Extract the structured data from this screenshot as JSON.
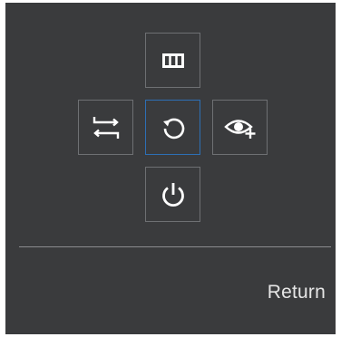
{
  "osd": {
    "tiles": {
      "top": {
        "icon": "picture-mode-icon"
      },
      "left": {
        "icon": "swap-arrows-icon"
      },
      "center": {
        "icon": "return-rotate-icon",
        "selected": true
      },
      "right": {
        "icon": "eye-saver-icon"
      },
      "bottom": {
        "icon": "power-icon"
      }
    },
    "footer": {
      "return_label": "Return"
    },
    "colors": {
      "background": "#3a3b3d",
      "tile_border": "#6e7073",
      "selected_border": "#2d6fb5",
      "icon": "#ffffff",
      "text": "#e6e6e6"
    }
  }
}
